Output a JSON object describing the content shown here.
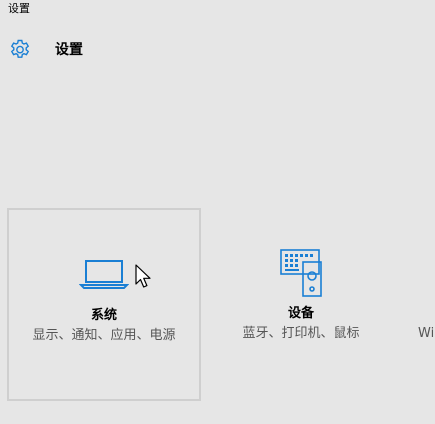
{
  "window": {
    "title": "设置"
  },
  "header": {
    "icon": "gear-icon",
    "title": "设置"
  },
  "tiles": [
    {
      "icon": "laptop-icon",
      "label": "系统",
      "description": "显示、通知、应用、电源",
      "selected": true
    },
    {
      "icon": "keyboard-speaker-icon",
      "label": "设备",
      "description": "蓝牙、打印机、鼠标",
      "selected": false
    }
  ],
  "partial_tile": {
    "text": "Wi"
  },
  "colors": {
    "accent": "#1a7fd4",
    "background": "#e6e6e6",
    "selection_border": "#cfcfcf",
    "secondary_text": "#555555"
  }
}
